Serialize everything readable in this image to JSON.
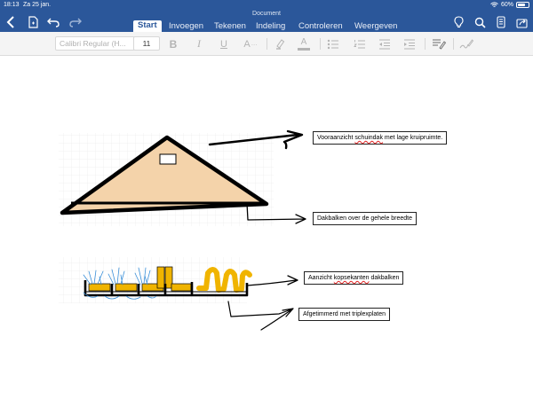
{
  "status": {
    "time": "18:13",
    "date": "Za 25 jan.",
    "battery": "60%"
  },
  "document": {
    "title": "Document"
  },
  "tabs": [
    {
      "label": "Start",
      "active": true
    },
    {
      "label": "Invoegen",
      "active": false
    },
    {
      "label": "Tekenen",
      "active": false
    },
    {
      "label": "Indeling",
      "active": false
    },
    {
      "label": "Controleren",
      "active": false
    },
    {
      "label": "Weergeven",
      "active": false
    }
  ],
  "toolbar": {
    "font_name": "Calibri Regular (H...",
    "font_size": "11",
    "bold": "B",
    "italic": "I",
    "underline": "U",
    "text_effects": "A",
    "font_color": "A"
  },
  "icons": {
    "back": "chevron-left-icon",
    "file": "file-icon",
    "undo": "undo-icon",
    "redo": "redo-icon",
    "lightbulb": "lightbulb-icon",
    "search": "search-icon",
    "phone": "phone-view-icon",
    "share": "share-icon",
    "highlighter": "highlighter-icon",
    "bullets": "bullet-list-icon",
    "numbering": "numbered-list-icon",
    "outdent": "outdent-icon",
    "indent": "indent-icon",
    "styles": "styles-icon",
    "draw": "pen-icon"
  },
  "colors": {
    "ribbon": "#2b579a",
    "roof_fill": "#f4d3aa",
    "beam_fill": "#f0b400",
    "wavy_underline": "#e02020",
    "scribble_blue": "#3a8fd8"
  },
  "annotations": {
    "roof_front": {
      "prefix": "Vooraanzicht ",
      "misspelled": "schuindak",
      "suffix": " met lage kruipruimte."
    },
    "rafters": {
      "text": "Dakbalken over de gehele breedte"
    },
    "beam_ends": {
      "prefix": "Aanzicht ",
      "misspelled": "kopsekanten",
      "suffix": " dakbalken"
    },
    "plywood": {
      "text": "Afgetimmerd met triplexplaten"
    }
  }
}
